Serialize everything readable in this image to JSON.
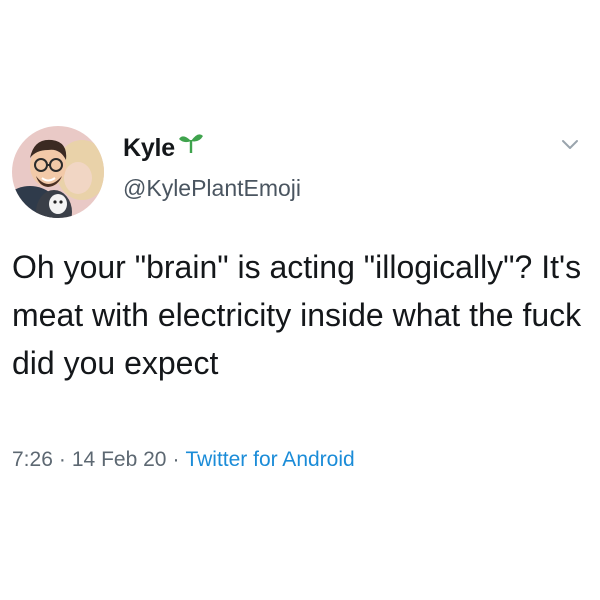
{
  "tweet": {
    "display_name": "Kyle",
    "name_emoji": "sprout-icon",
    "handle": "@KylePlantEmoji",
    "text": "Oh your \"brain\" is acting \"illogically\"? It's meat with electricity inside what the fuck did you expect",
    "time": "7:26",
    "separator": "·",
    "date": "14 Feb 20",
    "source": "Twitter for Android",
    "menu_icon": "chevron-down-icon"
  },
  "colors": {
    "text": "#14171a",
    "secondary": "#5d6872",
    "link": "#1b8cd8",
    "sprout": "#3fa34d",
    "avatar_bg": "#e8c4c4"
  }
}
